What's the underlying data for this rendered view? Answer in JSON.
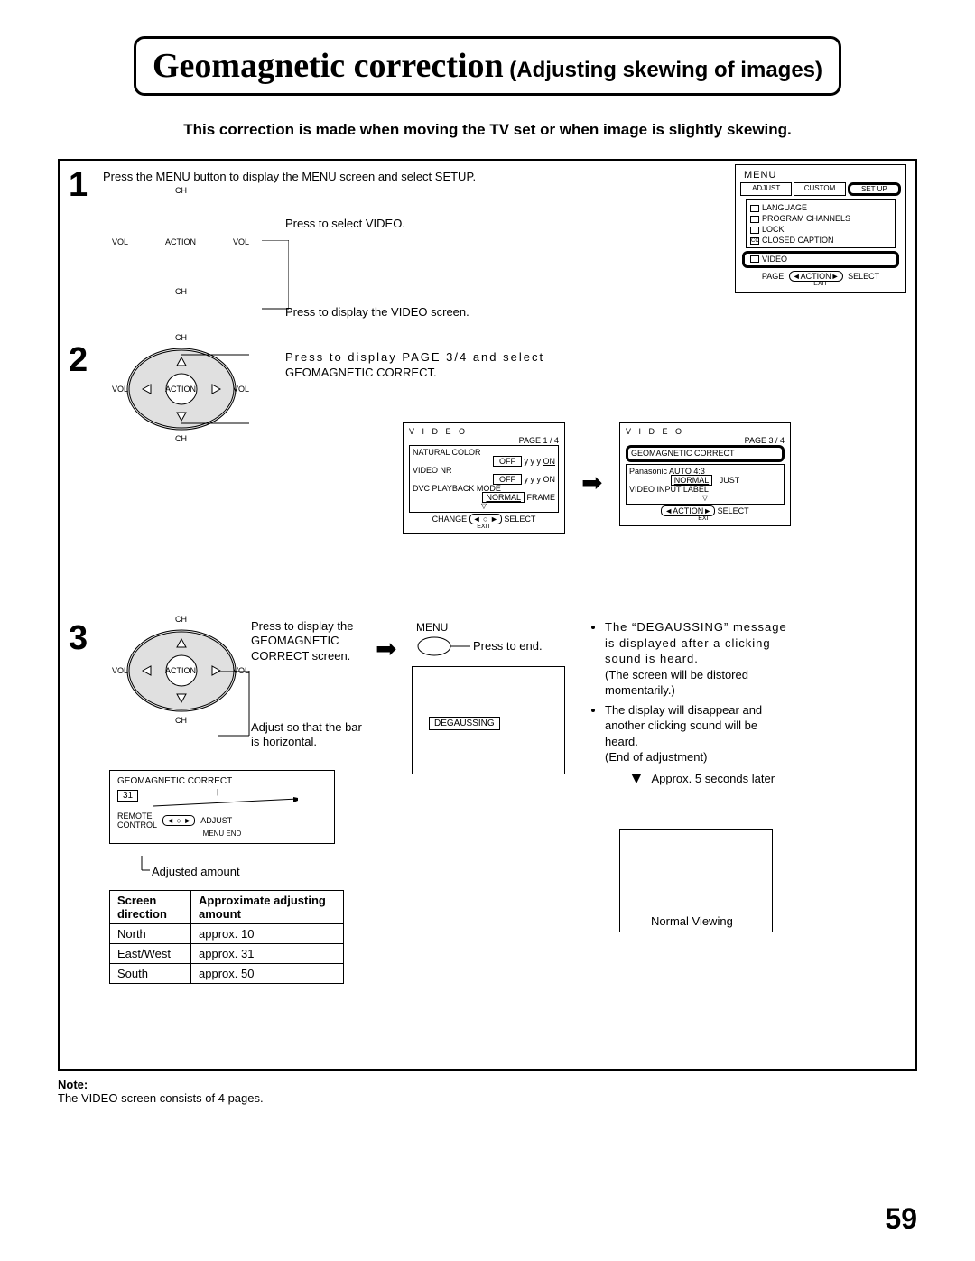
{
  "page_number": "59",
  "title": {
    "main": "Geomagnetic correction",
    "sub": " (Adjusting skewing of images)"
  },
  "intro": "This correction is made when moving the TV set or when image is slightly skewing.",
  "steps": {
    "s1": {
      "num": "1",
      "line1": "Press the MENU button to display the MENU screen and select SETUP.",
      "line2": "Press to select VIDEO.",
      "line3": "Press to display the VIDEO screen."
    },
    "s2": {
      "num": "2",
      "line1": "Press to display PAGE 3/4 and select GEOMAGNETIC CORRECT."
    },
    "s3": {
      "num": "3",
      "line1": "Press to display the GEOMAGNETIC CORRECT screen.",
      "line2": "Adjust so that the bar is horizontal.",
      "menu_label": "MENU",
      "press_end": "Press to end."
    }
  },
  "remote_labels": {
    "ch": "CH",
    "vol": "VOL",
    "action": "ACTION"
  },
  "menu_osd": {
    "title": "MENU",
    "tabs": {
      "adjust": "ADJUST",
      "custom": "CUSTOM",
      "setup": "SET  UP"
    },
    "items": {
      "language": "LANGUAGE",
      "program": "PROGRAM  CHANNELS",
      "lock": "LOCK",
      "cc": "CLOSED  CAPTION",
      "video": "VIDEO"
    },
    "footer": {
      "page": "PAGE",
      "action": "ACTION",
      "select": "SELECT",
      "exit": "EXIT"
    }
  },
  "video_osd_p1": {
    "title": "V I D E O",
    "page": "PAGE 1 / 4",
    "natural": "NATURAL  COLOR",
    "off": "OFF",
    "on": "ON",
    "yyy": "y y y",
    "nr": "VIDEO  NR",
    "dvc": "DVC  PLAYBACK  MODE",
    "normal": "NORMAL",
    "frame": "FRAME",
    "change": "CHANGE",
    "select": "SELECT",
    "exit": "EXIT"
  },
  "video_osd_p3": {
    "title": "V I D E O",
    "page": "PAGE 3 / 4",
    "geo": "GEOMAGNETIC  CORRECT",
    "pana": "Panasonic  AUTO   4:3",
    "normal": "NORMAL",
    "just": "JUST",
    "vil": "VIDEO  INPUT  LABEL",
    "action": "ACTION",
    "select": "SELECT",
    "exit": "EXIT"
  },
  "geo_osd": {
    "title": "GEOMAGNETIC  CORRECT",
    "value": "31",
    "remote": "REMOTE",
    "control": "CONTROL",
    "adjust": "ADJUST",
    "menu_end": "MENU   END",
    "adjusted": "Adjusted amount"
  },
  "direction_table": {
    "h1": "Screen direction",
    "h2": "Approximate adjusting amount",
    "r1c1": "North",
    "r1c2": "approx. 10",
    "r2c1": "East/West",
    "r2c2": "approx. 31",
    "r3c1": "South",
    "r3c2": "approx. 50"
  },
  "degauss": {
    "label": "DEGAUSSING",
    "b1": "The “DEGAUSSING” message is displayed after a clicking sound is heard.",
    "b1b": "(The screen will be distored momentarily.)",
    "b2": "The display will disappear and another clicking sound will be heard.",
    "b2b": "(End of adjustment)",
    "approx": "Approx. 5 seconds later",
    "normal": "Normal Viewing"
  },
  "note": {
    "label": "Note:",
    "text": "The VIDEO screen consists of 4 pages."
  }
}
